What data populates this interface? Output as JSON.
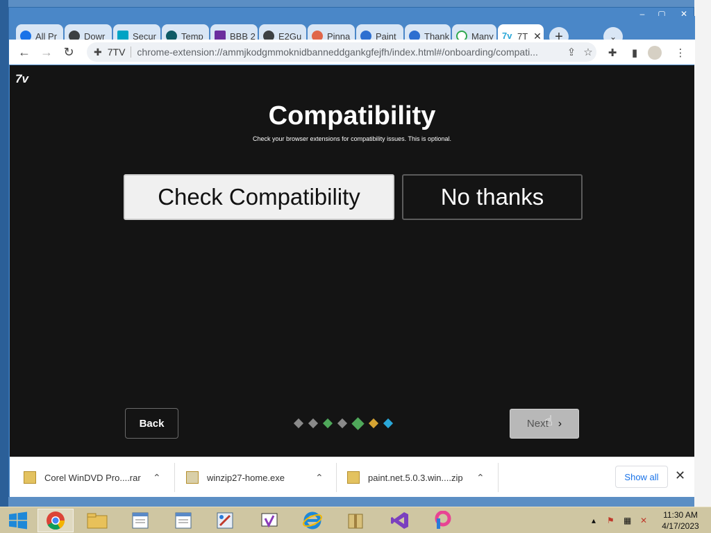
{
  "window": {
    "controls": [
      "–",
      "▢",
      "✕"
    ]
  },
  "tabs": [
    {
      "label": "All Pr",
      "color": "#1a73e8"
    },
    {
      "label": "Dowr",
      "color": "#3c4043"
    },
    {
      "label": "Secur",
      "color": "#00a3c4"
    },
    {
      "label": "Temp",
      "color": "#0e5a66"
    },
    {
      "label": "BBB 2",
      "color": "#6b2d9e"
    },
    {
      "label": "E2Gu",
      "color": "#3c4043"
    },
    {
      "label": "Pinna",
      "color": "#e0664a"
    },
    {
      "label": "Paint",
      "color": "#2e6fd0"
    },
    {
      "label": "Thank",
      "color": "#2e6fd0"
    },
    {
      "label": "Many",
      "color": "#2fa84f"
    },
    {
      "label": "7T",
      "color": "#2aa7d8",
      "active": true
    }
  ],
  "toolbar": {
    "site_name": "7TV",
    "url": "chrome-extension://ammjkodgmmoknidbanneddgankgfejfh/index.html#/onboarding/compati..."
  },
  "page": {
    "logo": "7v",
    "title": "Compatibility",
    "subtitle": "Check your browser extensions for compatibility issues. This is optional.",
    "check_button": "Check Compatibility",
    "no_button": "No thanks",
    "back_button": "Back",
    "next_button": "Next",
    "progress_dots": [
      {
        "color": "#8a8a8a"
      },
      {
        "color": "#8a8a8a"
      },
      {
        "color": "#4fa85a"
      },
      {
        "color": "#8a8a8a"
      },
      {
        "color": "#4fa85a",
        "current": true
      },
      {
        "color": "#d6a432"
      },
      {
        "color": "#2aa7d8"
      }
    ]
  },
  "downloads": {
    "items": [
      {
        "name": "Corel WinDVD Pro....rar"
      },
      {
        "name": "winzip27-home.exe"
      },
      {
        "name": "paint.net.5.0.3.win....zip"
      }
    ],
    "show_all": "Show all"
  },
  "taskbar": {
    "time": "11:30 AM",
    "date": "4/17/2023",
    "apps": [
      "start-icon",
      "chrome-icon",
      "file-explorer-icon",
      "notepad-icon",
      "notepad-icon",
      "paint-icon",
      "visual-studio-icon",
      "ie-icon",
      "archive-icon",
      "visual-studio-icon",
      "picsart-icon"
    ]
  }
}
